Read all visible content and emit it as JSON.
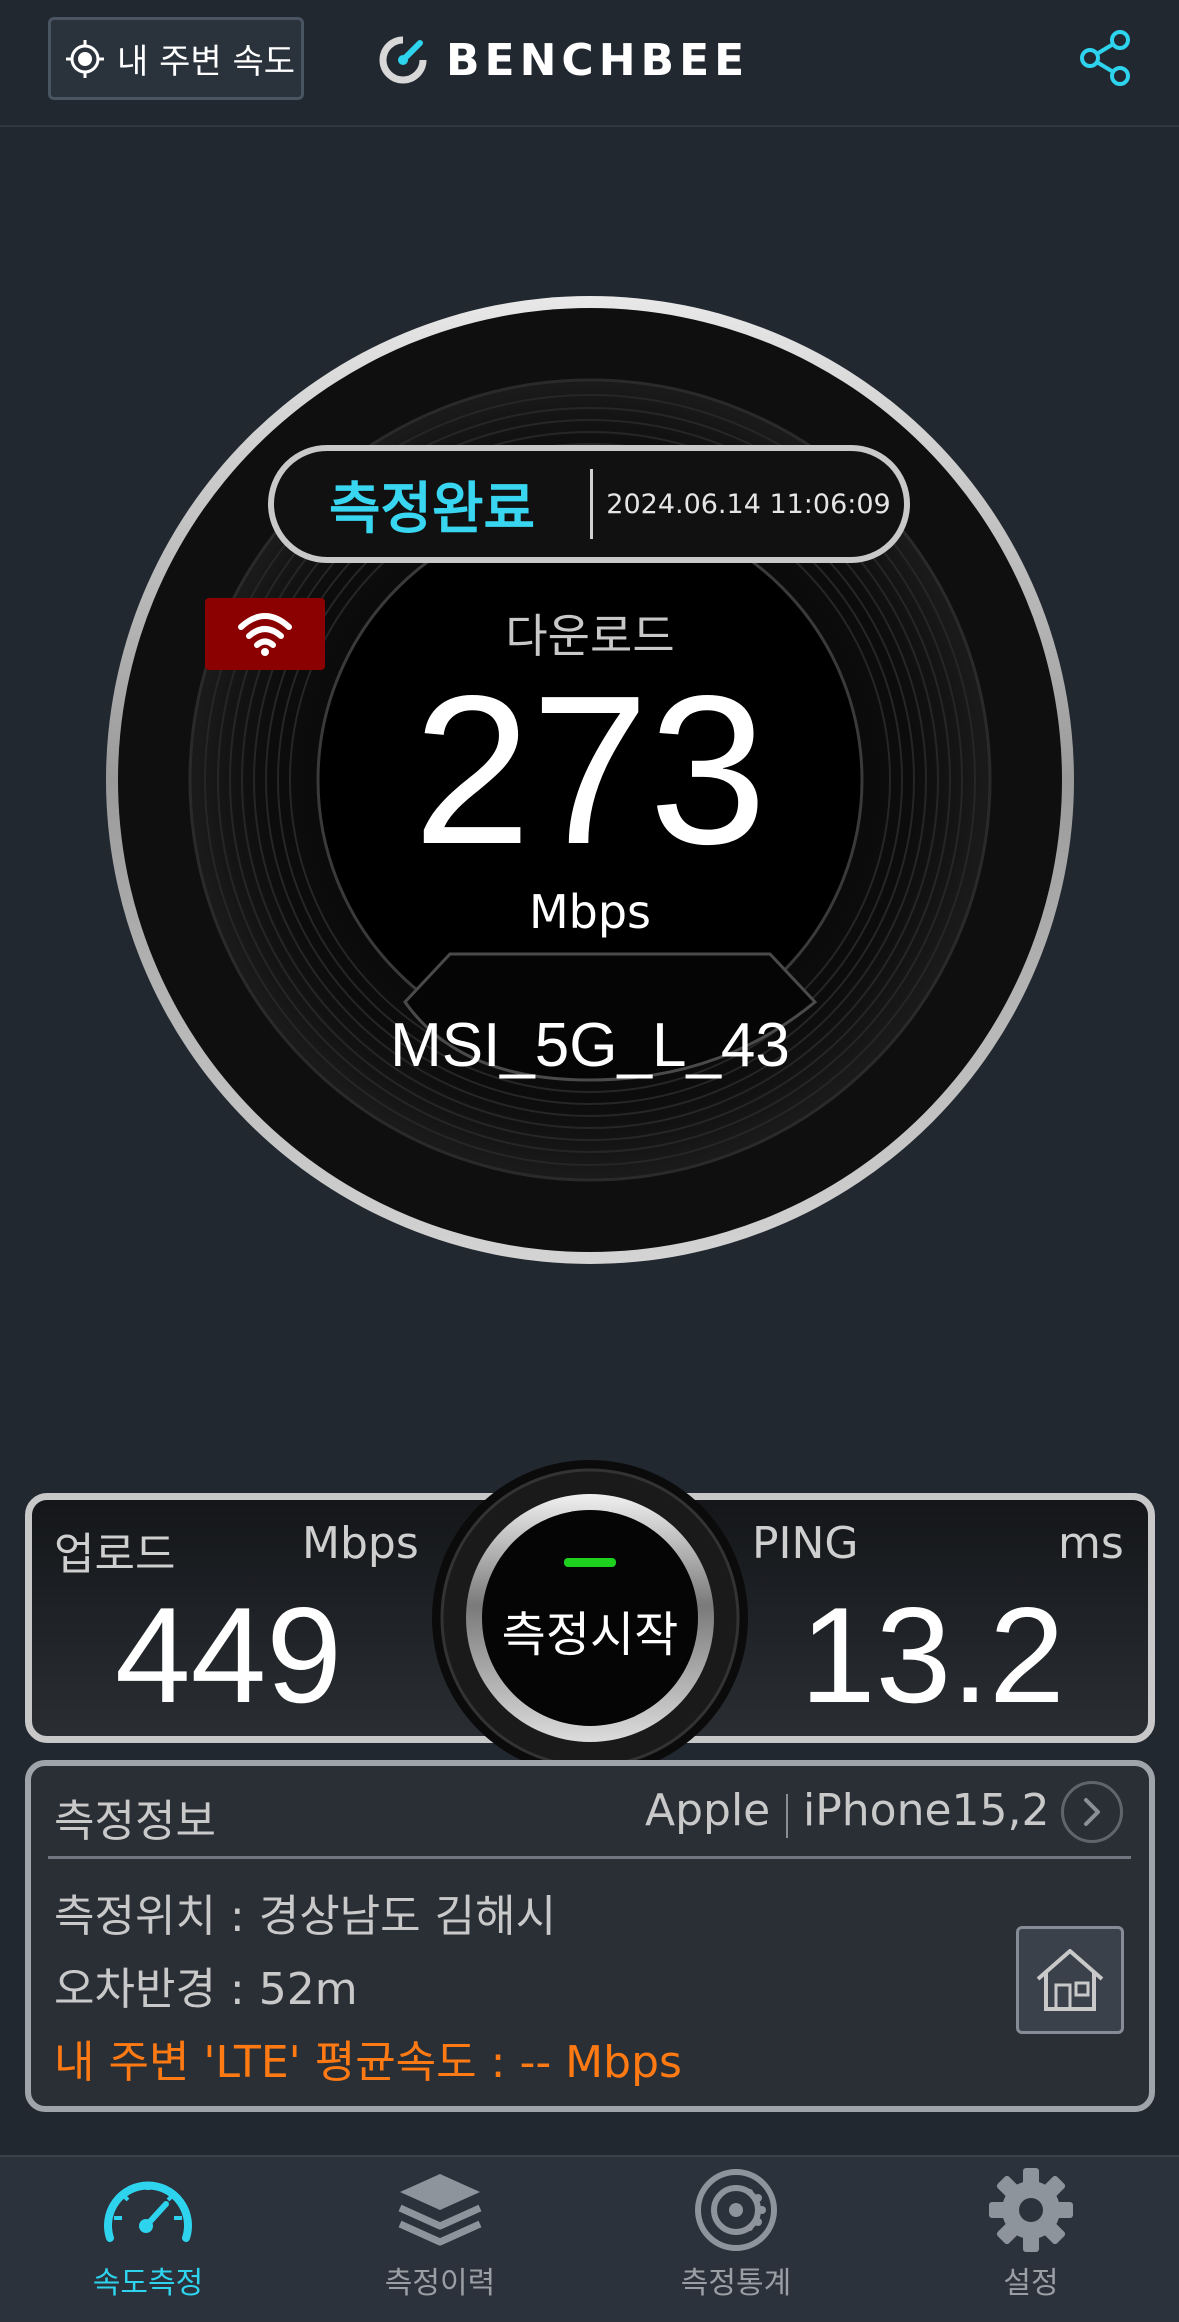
{
  "header": {
    "nearby_label": "내 주변 속도",
    "logo_text": "BENCHBEE"
  },
  "gauge": {
    "status": "측정완료",
    "timestamp": "2024.06.14 11:06:09",
    "connection_icon": "wifi-icon",
    "download_label": "다운로드",
    "download_value": "273",
    "download_unit": "Mbps",
    "network_name": "MSI_5G_L_43"
  },
  "results": {
    "upload_label": "업로드",
    "upload_unit": "Mbps",
    "upload_value": "449",
    "start_label": "측정시작",
    "ping_label": "PING",
    "ping_unit": "ms",
    "ping_value": "13.2"
  },
  "info": {
    "title": "측정정보",
    "brand": "Apple",
    "model": "iPhone15,2",
    "location": "측정위치 : 경상남도 김해시",
    "error_radius": "오차반경 : 52m",
    "nearby_average": "내 주변 'LTE' 평균속도 : -- Mbps"
  },
  "nav": [
    {
      "label": "속도측정",
      "icon": "speedometer-icon",
      "active": true
    },
    {
      "label": "측정이력",
      "icon": "layers-icon",
      "active": false
    },
    {
      "label": "측정통계",
      "icon": "stats-disc-icon",
      "active": false
    },
    {
      "label": "설정",
      "icon": "gear-icon",
      "active": false
    }
  ],
  "colors": {
    "accent": "#2ed3ee",
    "background": "#212830",
    "wifi_badge": "#8b0000",
    "orange_text": "#ff7a12"
  }
}
